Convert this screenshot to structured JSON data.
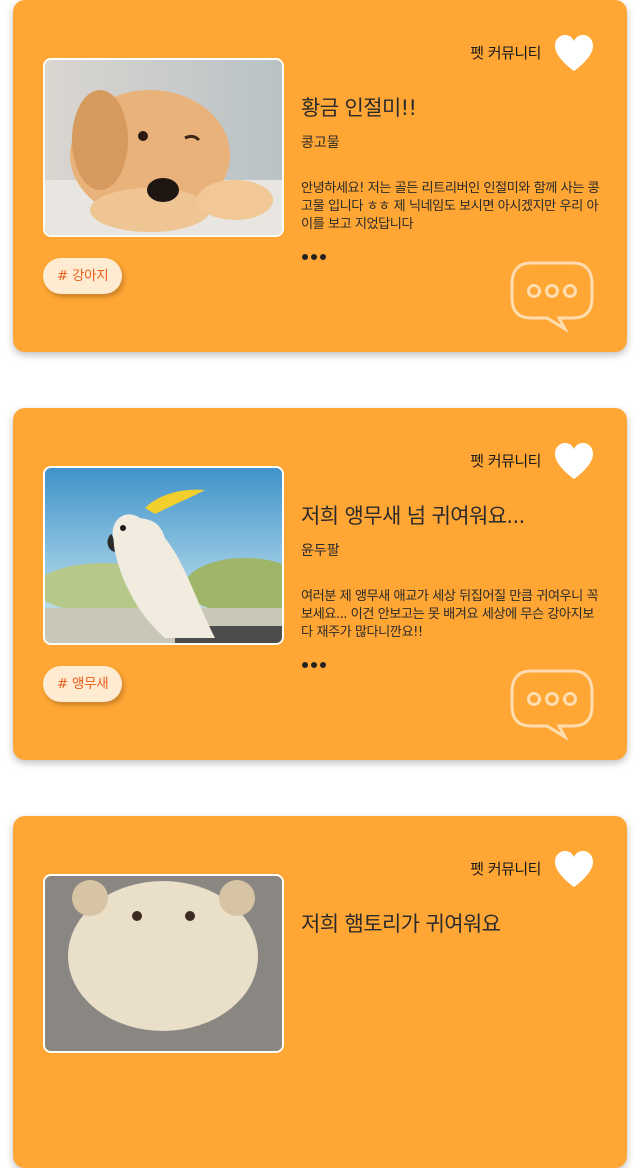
{
  "posts": [
    {
      "category": "펫 커뮤니티",
      "title": "황금 인절미!!",
      "author": "콩고물",
      "excerpt": "안녕하세요! 저는 골든 리트리버인 인절미와 함께 사는 콩고물 입니다 ㅎㅎ 제 닉네임도 보시면 아시겠지만 우리 아이를 보고 지었답니다",
      "tag": "# 강아지",
      "image": "golden-retriever-puppy-photo"
    },
    {
      "category": "펫 커뮤니티",
      "title": "저희 앵무새 넘 귀여워요...",
      "author": "윤두팔",
      "excerpt": "여러분 제 앵무새 애교가 세상 뒤집어질 만큼 귀여우니 꼭 보세요... 이건 안보고는 못 배겨요 세상에 무슨 강아지보다 재주가 많다니깐요!!",
      "tag": "# 앵무새",
      "image": "cockatoo-parrot-photo"
    },
    {
      "category": "펫 커뮤니티",
      "title": "저희 햄토리가 귀여워요",
      "author": "",
      "excerpt": "",
      "tag": "",
      "image": "hamster-in-bear-hat-photo"
    }
  ],
  "icons": {
    "like": "heart-icon",
    "more": "more-dots-icon",
    "comment": "speech-bubble-icon"
  },
  "colors": {
    "card": "#FFA634",
    "tag_bg": "#FFEBD2",
    "tag_text": "#E8601C",
    "icon": "#FFFFFF"
  }
}
